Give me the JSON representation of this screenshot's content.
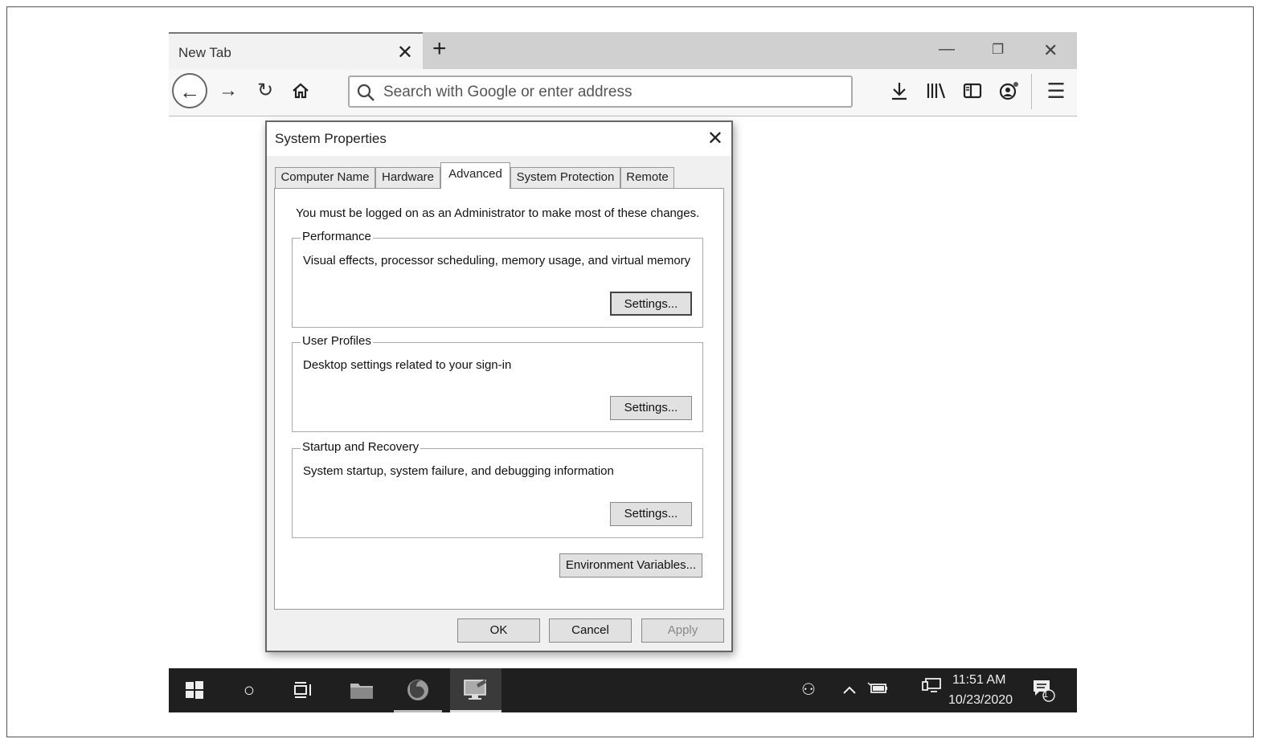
{
  "browser": {
    "tab_title": "New Tab",
    "url_placeholder": "Search with Google or enter address"
  },
  "dialog": {
    "title": "System Properties",
    "tabs": [
      {
        "label": "Computer Name",
        "active": false
      },
      {
        "label": "Hardware",
        "active": false
      },
      {
        "label": "Advanced",
        "active": true
      },
      {
        "label": "System Protection",
        "active": false
      },
      {
        "label": "Remote",
        "active": false
      }
    ],
    "admin_note": "You must be logged on as an Administrator to make most of these changes.",
    "groups": [
      {
        "label": "Performance",
        "description": "Visual effects, processor scheduling, memory usage, and virtual memory",
        "button": "Settings..."
      },
      {
        "label": "User Profiles",
        "description": "Desktop settings related to your sign-in",
        "button": "Settings..."
      },
      {
        "label": "Startup and Recovery",
        "description": "System startup, system failure, and debugging information",
        "button": "Settings..."
      }
    ],
    "env_button": "Environment Variables...",
    "ok_button": "OK",
    "cancel_button": "Cancel",
    "apply_button": "Apply"
  },
  "taskbar": {
    "time": "11:51 AM",
    "date": "10/23/2020",
    "notification_count": "1"
  },
  "icons": [
    "close-icon",
    "plus-icon",
    "minimize-icon",
    "restore-icon",
    "back-arrow-icon",
    "forward-arrow-icon",
    "reload-icon",
    "home-icon",
    "search-icon",
    "download-icon",
    "library-icon",
    "sidebar-icon",
    "account-icon",
    "menu-icon",
    "windows-logo-icon",
    "cortana-circle-icon",
    "task-view-icon",
    "file-explorer-icon",
    "firefox-icon",
    "system-properties-icon",
    "people-icon",
    "chevron-up-icon",
    "battery-icon",
    "network-icon",
    "notification-icon"
  ]
}
